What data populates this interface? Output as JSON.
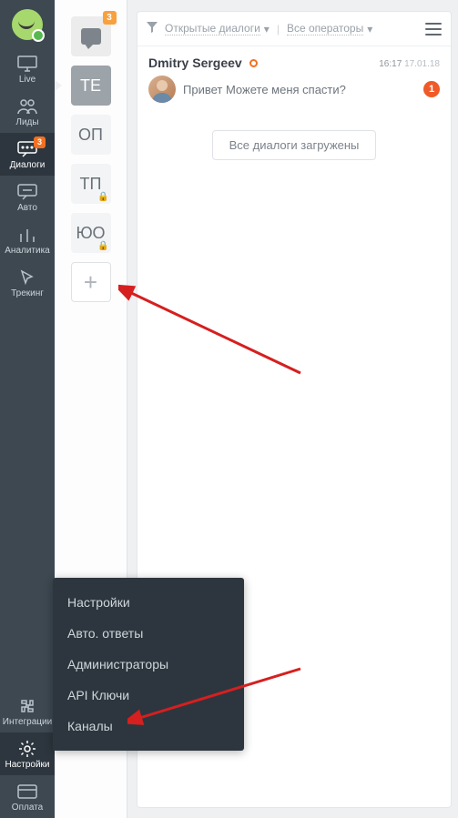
{
  "sidebar": {
    "items": [
      {
        "id": "live",
        "label": "Live"
      },
      {
        "id": "leads",
        "label": "Лиды"
      },
      {
        "id": "dialogs",
        "label": "Диалоги",
        "badge": "3",
        "active": true
      },
      {
        "id": "auto",
        "label": "Авто"
      },
      {
        "id": "analytics",
        "label": "Аналитика"
      },
      {
        "id": "tracking",
        "label": "Трекинг"
      }
    ],
    "bottom": [
      {
        "id": "integrations",
        "label": "Интеграции"
      },
      {
        "id": "settings",
        "label": "Настройки",
        "active": true
      },
      {
        "id": "payment",
        "label": "Оплата"
      }
    ]
  },
  "operators": {
    "tiles": [
      {
        "id": "me",
        "type": "icon",
        "badge": "3"
      },
      {
        "id": "te",
        "initials": "ТЕ",
        "selected": true
      },
      {
        "id": "op",
        "initials": "ОП"
      },
      {
        "id": "tp",
        "initials": "ТП",
        "locked": true
      },
      {
        "id": "yuo",
        "initials": "ЮО",
        "locked": true
      }
    ],
    "add_label": "+"
  },
  "toolbar": {
    "open_dialogs": "Открытые диалоги",
    "all_operators": "Все операторы"
  },
  "dialog": {
    "name": "Dmitry Sergeev",
    "time": "16:17",
    "date": "17.01.18",
    "message": "Привет Можете меня спасти?",
    "unread": "1"
  },
  "all_loaded": "Все диалоги загружены",
  "popup": {
    "items": [
      "Настройки",
      "Авто. ответы",
      "Администраторы",
      "API Ключи",
      "Каналы"
    ]
  },
  "colors": {
    "accent": "#f37021",
    "sidebar_bg": "#3d4851",
    "popup_bg": "#2d363e",
    "unread": "#f05a28"
  }
}
